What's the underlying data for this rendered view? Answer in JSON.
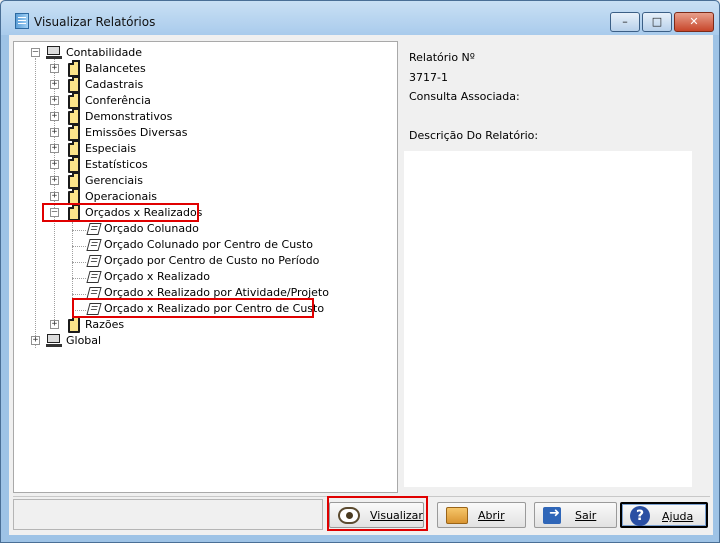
{
  "window": {
    "title": "Visualizar Relatórios"
  },
  "controls": {
    "minimize": "–",
    "maximize": "□",
    "close": "✕"
  },
  "tree": {
    "roots": [
      {
        "label": "Contabilidade",
        "expanded": true
      },
      {
        "label": "Global",
        "expanded": false
      }
    ],
    "groups": [
      "Balancetes",
      "Cadastrais",
      "Conferência",
      "Demonstrativos",
      "Emissões Diversas",
      "Especiais",
      "Estatísticos",
      "Gerenciais",
      "Operacionais",
      "Orçados x Realizados",
      "Razões"
    ],
    "orcados_children": [
      "Orçado Colunado",
      "Orçado Colunado por Centro de Custo",
      "Orçado por Centro de Custo no Período",
      "Orçado x Realizado",
      "Orçado x Realizado por Atividade/Projeto",
      "Orçado x Realizado por Centro de Custo"
    ],
    "expander_plus": "+",
    "expander_minus": "–"
  },
  "info": {
    "report_number_label": "Relatório Nº",
    "report_number_value": "3717-1",
    "associated_query_label": "Consulta Associada:",
    "description_label": "Descrição Do Relatório:"
  },
  "buttons": {
    "visualizar": "Visualizar",
    "abrir": "Abrir",
    "sair": "Sair",
    "ajuda": "Ajuda",
    "help_glyph": "?"
  },
  "icons": {
    "app": "report-app-icon",
    "root": "computer-icon",
    "group": "folder-icon",
    "report": "report-icon",
    "visualizar": "eye-icon",
    "abrir": "open-folder-icon",
    "sair": "exit-icon",
    "ajuda": "help-icon"
  },
  "colors": {
    "highlight": "#e00000",
    "title_bar": "#a9cbec",
    "folder": "#fbe48a"
  }
}
